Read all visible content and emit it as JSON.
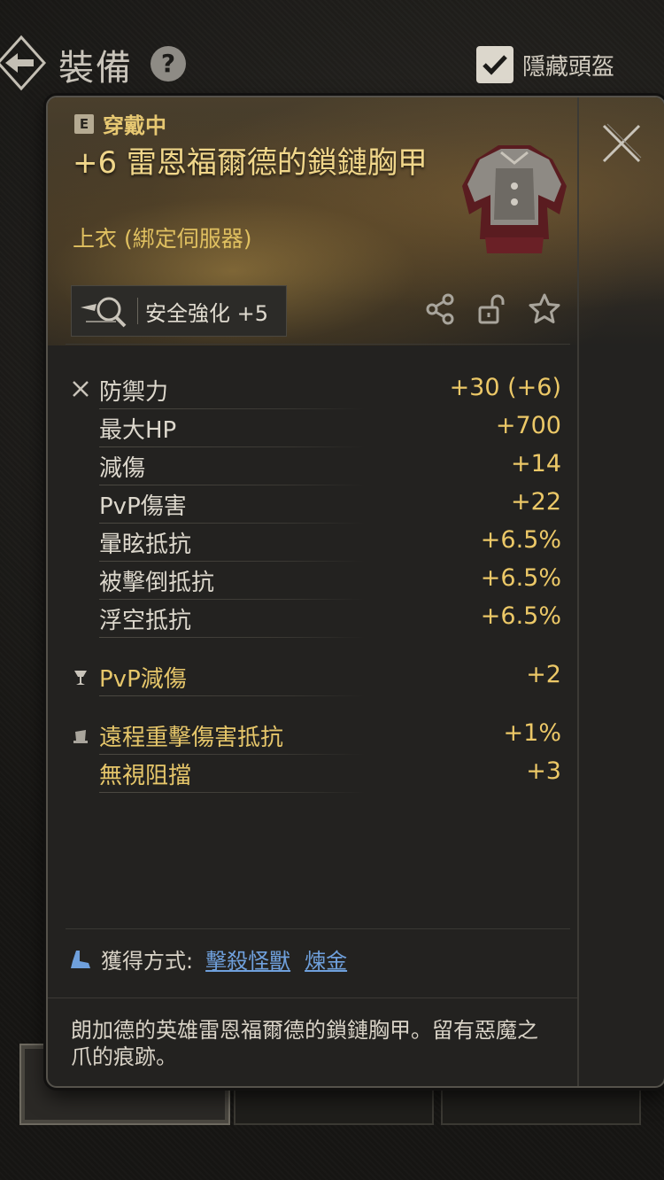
{
  "header": {
    "title": "裝備",
    "help_icon": "question-circle-icon",
    "hide_helmet_label": "隱藏頭盔",
    "hide_helmet_checked": true
  },
  "item": {
    "equip_mark": "E",
    "equip_status": "穿戴中",
    "name": "+6 雷恩福爾德的鎖鏈胸甲",
    "type": "上衣 (綁定伺服器)",
    "enhance_label": "安全強化 +5",
    "actions": [
      "share-icon",
      "unlock-icon",
      "star-icon"
    ]
  },
  "stats": {
    "base": [
      {
        "name": "防禦力",
        "value": "+30 (+6)"
      },
      {
        "name": "最大HP",
        "value": "+700"
      },
      {
        "name": "減傷",
        "value": "+14"
      },
      {
        "name": "PvP傷害",
        "value": "+22"
      },
      {
        "name": "暈眩抵抗",
        "value": "+6.5%"
      },
      {
        "name": "被擊倒抵抗",
        "value": "+6.5%"
      },
      {
        "name": "浮空抵抗",
        "value": "+6.5%"
      }
    ],
    "special": [
      {
        "name": "PvP減傷",
        "value": "+2"
      }
    ],
    "bonus": [
      {
        "name": "遠程重擊傷害抵抗",
        "value": "+1%"
      },
      {
        "name": "無視阻擋",
        "value": "+3"
      }
    ]
  },
  "acquisition": {
    "label": "獲得方式:",
    "links": [
      "擊殺怪獸",
      "煉金"
    ]
  },
  "description": "朗加德的英雄雷恩福爾德的鎖鏈胸甲。留有惡魔之爪的痕跡。",
  "rail": {
    "icons": [
      "book-icon",
      "scales-icon",
      "tome-icon",
      "rune-emblem-icon",
      "anvil-icon",
      "engrave-e-icon"
    ]
  },
  "colors": {
    "gold": "#ecc867",
    "link": "#6fa0dc",
    "panel": "#232220"
  }
}
